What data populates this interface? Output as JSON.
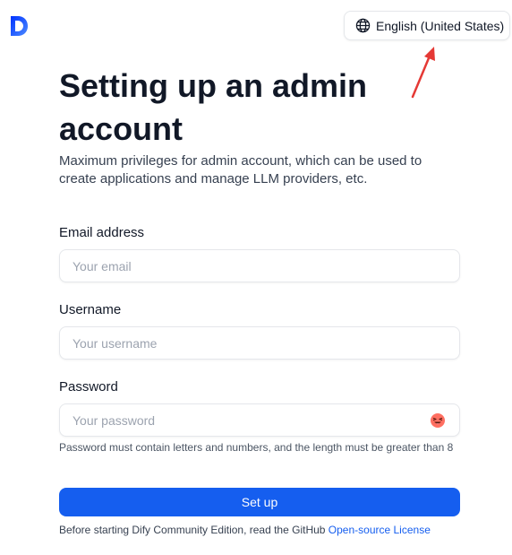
{
  "header": {
    "logo_icon": "dify-logo-icon",
    "language": {
      "label": "English (United States)",
      "icon": "globe-icon"
    },
    "annotation_color": "#e53935"
  },
  "main": {
    "title": "Setting up an admin account",
    "subtitle": "Maximum privileges for admin account, which can be used to create applications and manage LLM providers, etc.",
    "email": {
      "label": "Email address",
      "placeholder": "Your email",
      "value": ""
    },
    "username": {
      "label": "Username",
      "placeholder": "Your username",
      "value": ""
    },
    "password": {
      "label": "Password",
      "placeholder": "Your password",
      "value": "",
      "toggle_icon": "emoji-face-icon",
      "hint": "Password must contain letters and numbers, and the length must be greater than 8"
    },
    "submit_label": "Set up",
    "footer": {
      "text": "Before starting Dify Community Edition, read the GitHub ",
      "link_label": "Open-source License"
    },
    "accent_color": "#155eef"
  }
}
